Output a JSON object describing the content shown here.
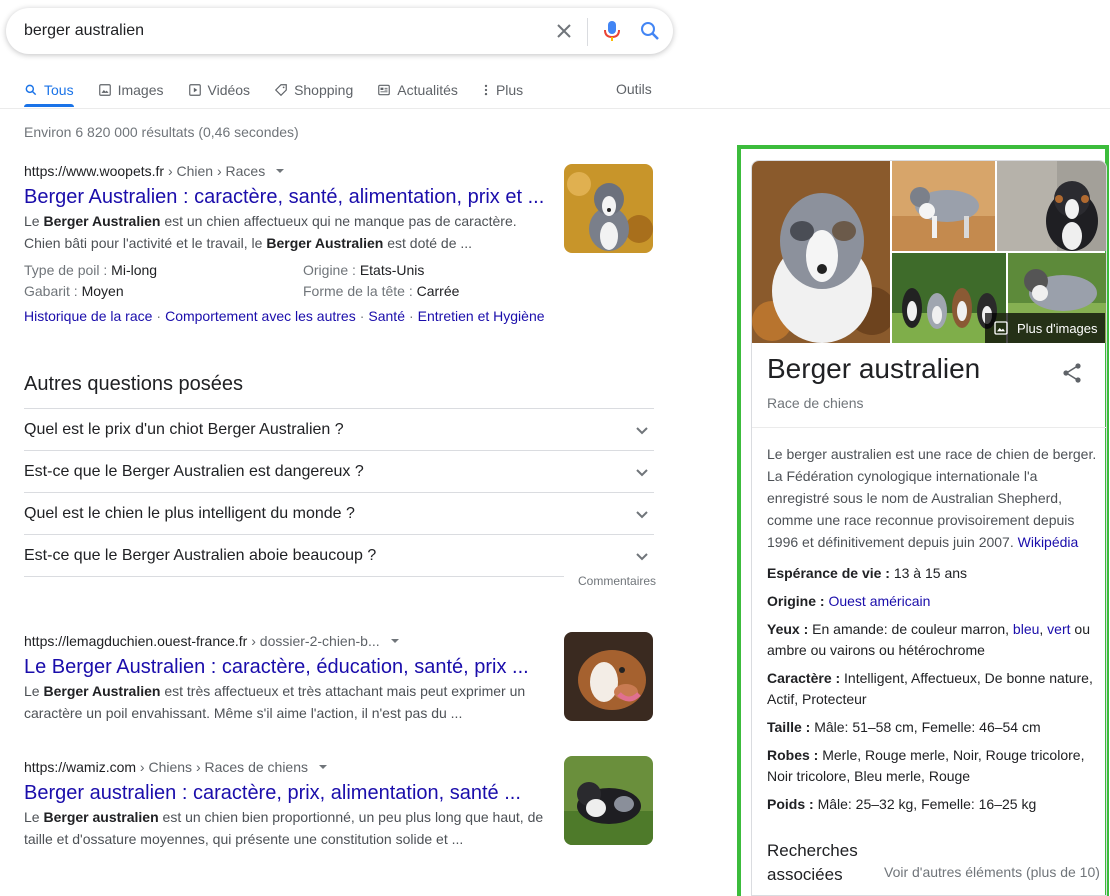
{
  "search": {
    "query": "berger australien"
  },
  "tabs": [
    {
      "label": "Tous"
    },
    {
      "label": "Images"
    },
    {
      "label": "Vidéos"
    },
    {
      "label": "Shopping"
    },
    {
      "label": "Actualités"
    },
    {
      "label": "Plus"
    }
  ],
  "tools_label": "Outils",
  "result_stats": "Environ 6 820 000 résultats (0,46 secondes)",
  "results": [
    {
      "cite_domain": "https://www.woopets.fr",
      "cite_path": " › Chien › Races",
      "title": "Berger Australien : caractère, santé, alimentation, prix et ...",
      "snippet_parts": [
        "Le ",
        "Berger Australien",
        " est un chien affectueux qui ne manque pas de caractère. Chien bâti pour l'activité et le travail, le ",
        "Berger Australien",
        " est doté de ..."
      ],
      "facts": [
        {
          "label": "Type de poil : ",
          "value": "Mi-long"
        },
        {
          "label": "Origine : ",
          "value": "Etats-Unis"
        },
        {
          "label": "Gabarit : ",
          "value": "Moyen"
        },
        {
          "label": "Forme de la tête : ",
          "value": "Carrée"
        }
      ],
      "sitelinks": [
        "Historique de la race",
        "Comportement avec les autres",
        "Santé",
        "Entretien et Hygiène"
      ]
    },
    {
      "cite_domain": "https://lemagduchien.ouest-france.fr",
      "cite_path": " › dossier-2-chien-b...",
      "title": "Le Berger Australien : caractère, éducation, santé, prix ...",
      "snippet_parts": [
        "Le ",
        "Berger Australien",
        " est très affectueux et très attachant mais peut exprimer un caractère un poil envahissant. Même s'il aime l'action, il n'est pas du ..."
      ]
    },
    {
      "cite_domain": "https://wamiz.com",
      "cite_path": " › Chiens › Races de chiens",
      "title": "Berger australien : caractère, prix, alimentation, santé ...",
      "snippet_parts": [
        "Le ",
        "Berger australien",
        " est un chien bien proportionné, un peu plus long que haut, de taille et d'ossature moyennes, qui présente une constitution solide et ..."
      ]
    }
  ],
  "paa": {
    "title": "Autres questions posées",
    "questions": [
      "Quel est le prix d'un chiot Berger Australien ?",
      "Est-ce que le Berger Australien est dangereux ?",
      "Quel est le chien le plus intelligent du monde ?",
      "Est-ce que le Berger Australien aboie beaucoup ?"
    ],
    "feedback": "Commentaires"
  },
  "knowledge_panel": {
    "more_images": "Plus d'images",
    "title": "Berger australien",
    "subtitle": "Race de chiens",
    "description": "Le berger australien est une race de chien de berger. La Fédération cynologique internationale l'a enregistré sous le nom de Australian Shepherd, comme une race reconnue provisoirement depuis 1996 et définitivement depuis juin 2007. ",
    "description_link": "Wikipédia",
    "facts": {
      "esperance_label": "Espérance de vie : ",
      "esperance_value": "13 à 15 ans",
      "origine_label": "Origine : ",
      "origine_value": "Ouest américain",
      "yeux_label": "Yeux : ",
      "yeux_text1": "En amande: de couleur marron, ",
      "yeux_link1": "bleu",
      "yeux_sep": ", ",
      "yeux_link2": "vert",
      "yeux_text2": " ou ambre ou vairons ou hétérochrome",
      "caractere_label": "Caractère : ",
      "caractere_value": "Intelligent, Affectueux, De bonne nature, Actif, Protecteur",
      "taille_label": "Taille : ",
      "taille_value": "Mâle: 51–58 cm, Femelle: 46–54 cm",
      "robes_label": "Robes : ",
      "robes_value": "Merle, Rouge merle, Noir, Rouge tricolore, Noir tricolore, Bleu merle, Rouge",
      "poids_label": "Poids : ",
      "poids_value": "Mâle: 25–32 kg, Femelle: 16–25 kg"
    },
    "related_title": "Recherches associées",
    "related_more": "Voir d'autres éléments (plus de 10)"
  },
  "colors": {
    "accent": "#1a73e8",
    "link": "#1a0dab",
    "highlight": "#3cbc3c"
  }
}
